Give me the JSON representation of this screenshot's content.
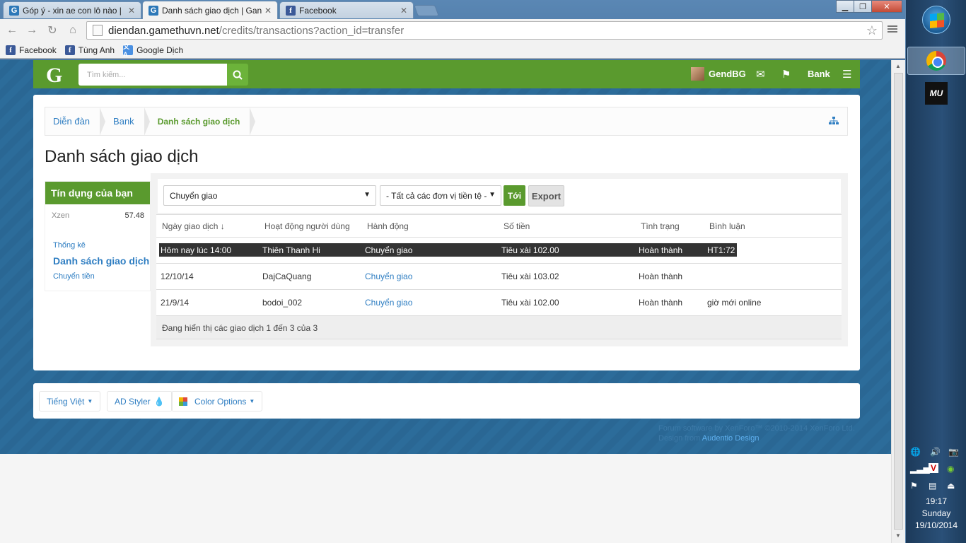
{
  "browser": {
    "tabs": [
      {
        "title": "Góp ý - xin ae con lô nào |",
        "favicon": "g-icon"
      },
      {
        "title": "Danh sách giao dịch | Gan",
        "favicon": "g-icon"
      },
      {
        "title": "Facebook",
        "favicon": "facebook-icon"
      }
    ],
    "url_host": "diendan.gamethuvn.net",
    "url_path": "/credits/transactions?action_id=transfer",
    "bookmarks": [
      {
        "label": "Facebook"
      },
      {
        "label": "Tùng Anh"
      },
      {
        "label": "Google Dịch"
      }
    ]
  },
  "site": {
    "logo": "G",
    "search_placeholder": "Tìm kiếm...",
    "username": "GendBG",
    "bank_label": "Bank",
    "accent": "#5a9a2e",
    "link_color": "#2f7ec2"
  },
  "breadcrumb": [
    "Diễn đàn",
    "Bank",
    "Danh sách giao dịch"
  ],
  "page_title": "Danh sách giao dịch",
  "sidebar": {
    "heading": "Tín dụng của bạn",
    "credit_name": "Xzen",
    "credit_value": "57.48",
    "links": [
      "Thống kê",
      "Danh sách giao dịch",
      "Chuyển tiền"
    ]
  },
  "filters": {
    "action_select": "Chuyển giao",
    "currency_select": "- Tất cả các đơn vị tiền tệ -",
    "go_label": "Tới",
    "export_label": "Export"
  },
  "table": {
    "headers": [
      "Ngày giao dịch ↓",
      "Hoạt động người dùng",
      "Hành động",
      "Số tiền",
      "Tình trạng",
      "Bình luận"
    ],
    "rows": [
      {
        "date": "Hôm nay lúc 14:00",
        "user": "Thiên Thanh Hi",
        "action": "Chuyển giao",
        "amount": "Tiêu xài 102.00",
        "status": "Hoàn thành",
        "comment": "HT1:72"
      },
      {
        "date": "12/10/14",
        "user": "DajCaQuang",
        "action": "Chuyển giao",
        "amount": "Tiêu xài 103.02",
        "status": "Hoàn thành",
        "comment": ""
      },
      {
        "date": "21/9/14",
        "user": "bodoi_002",
        "action": "Chuyển giao",
        "amount": "Tiêu xài 102.00",
        "status": "Hoàn thành",
        "comment": "giờ mới online"
      }
    ],
    "footer": "Đang hiển thị các giao dịch 1 đến 3 của 3"
  },
  "footer": {
    "language": "Tiếng Việt",
    "style": "AD Styler",
    "color_options": "Color Options",
    "copyright_line1": "Forum software by XenForo™ ©2010-2014 XenForo Ltd.",
    "design_prefix": "Design from ",
    "design_link": "Audentio Design"
  },
  "taskbar": {
    "time": "19:17",
    "day": "Sunday",
    "date": "19/10/2014"
  }
}
